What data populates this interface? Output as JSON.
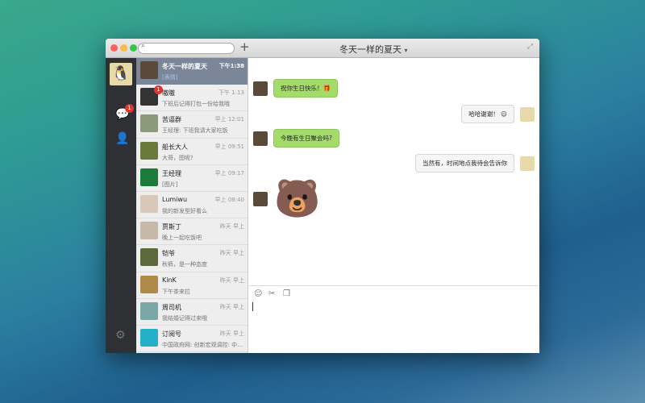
{
  "window": {
    "title": "冬天一样的夏天",
    "title_arrow": "▾",
    "search_icon": "⌕",
    "plus": "+",
    "expand": "⤢"
  },
  "sidebar": {
    "me_avatar": "🐧",
    "chat_icon": "💬",
    "chat_badge": "1",
    "contacts_icon": "👤",
    "settings_icon": "⚙"
  },
  "conversations": [
    {
      "name": "冬天一样的夏天",
      "time": "下午1:38",
      "preview": "[表情]",
      "color": "#5a4a3a"
    },
    {
      "name": "嗷嗷",
      "time": "下午 1:13",
      "preview": "下班后记得打包一份给我哦",
      "badge": "1",
      "color": "#333"
    },
    {
      "name": "苦逼群",
      "time": "早上 12:01",
      "preview": "王经理: 下班我请大家吃饭",
      "color": "#8a9a7a"
    },
    {
      "name": "船长大人",
      "time": "早上 09:51",
      "preview": "大哥，图呢?",
      "color": "#6a7a3a"
    },
    {
      "name": "王经理",
      "time": "早上 09:17",
      "preview": "[图片]",
      "color": "#1c7a3a"
    },
    {
      "name": "Lumiwu",
      "time": "早上 08:40",
      "preview": "我的新发型好看么",
      "color": "#d8c8b8"
    },
    {
      "name": "贾斯丁",
      "time": "昨天 早上",
      "preview": "晚上一起吃饭吧",
      "color": "#c8b8a8"
    },
    {
      "name": "铠爷",
      "time": "昨天 早上",
      "preview": "秋裤，是一种态度",
      "color": "#5a6a3a"
    },
    {
      "name": "KinK",
      "time": "昨天 早上",
      "preview": "下午茶来拉",
      "color": "#b08a4a"
    },
    {
      "name": "周司机",
      "time": "昨天 早上",
      "preview": "我结婚记得过来哦",
      "color": "#7aa8a8"
    },
    {
      "name": "订阅号",
      "time": "昨天 早上",
      "preview": "中国政府网: 创新宏观调控: 中…",
      "color": "#23b0c8"
    }
  ],
  "messages": [
    {
      "side": "left",
      "text": "祝你生日快乐！🎁"
    },
    {
      "side": "right",
      "text": "哈哈谢谢！ ☺"
    },
    {
      "side": "left",
      "text": "今晚有生日聚会吗?"
    },
    {
      "side": "right",
      "text": "当然有，时间地点我待会告诉你"
    }
  ],
  "sticker": "🐻",
  "input": {
    "emoji_icon": "☺",
    "scissors_icon": "✂",
    "file_icon": "❐"
  }
}
